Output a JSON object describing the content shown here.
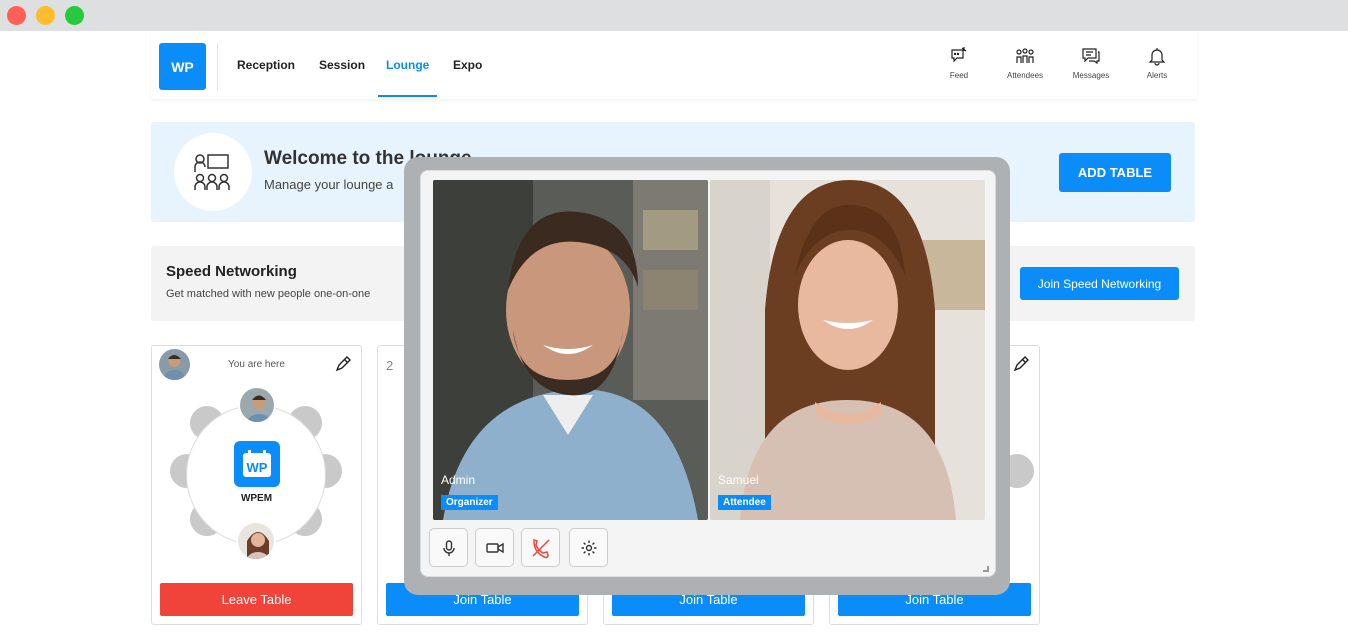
{
  "brand": {
    "logo_text": "WP",
    "accent": "#0a8df8",
    "danger": "#f0433a"
  },
  "nav": [
    {
      "label": "Reception",
      "active": false
    },
    {
      "label": "Session",
      "active": false
    },
    {
      "label": "Lounge",
      "active": true
    },
    {
      "label": "Expo",
      "active": false
    }
  ],
  "header_actions": [
    {
      "label": "Feed",
      "icon": "feed-icon"
    },
    {
      "label": "Attendees",
      "icon": "attendees-icon"
    },
    {
      "label": "Messages",
      "icon": "messages-icon"
    },
    {
      "label": "Alerts",
      "icon": "bell-icon"
    }
  ],
  "welcome": {
    "title": "Welcome to the lounge",
    "subtitle": "Manage your lounge a",
    "add_table": "ADD TABLE",
    "icon": "people-meeting-icon"
  },
  "speed": {
    "title": "Speed Networking",
    "subtitle": "Get matched with new people one-on-one",
    "button": "Join Speed Networking"
  },
  "tables": [
    {
      "number": "",
      "status": "You are here",
      "center_label": "WPEM",
      "button": "Leave Table"
    },
    {
      "number": "2",
      "button": "Join Table"
    },
    {
      "number": "",
      "button": "Join Table"
    },
    {
      "number": "",
      "button": "Join Table"
    }
  ],
  "call": {
    "participants": [
      {
        "name": "Admin",
        "role": "Organizer"
      },
      {
        "name": "Samuel",
        "role": "Attendee"
      }
    ],
    "controls": [
      "microphone-icon",
      "video-camera-icon",
      "hang-up-icon",
      "settings-icon"
    ]
  }
}
